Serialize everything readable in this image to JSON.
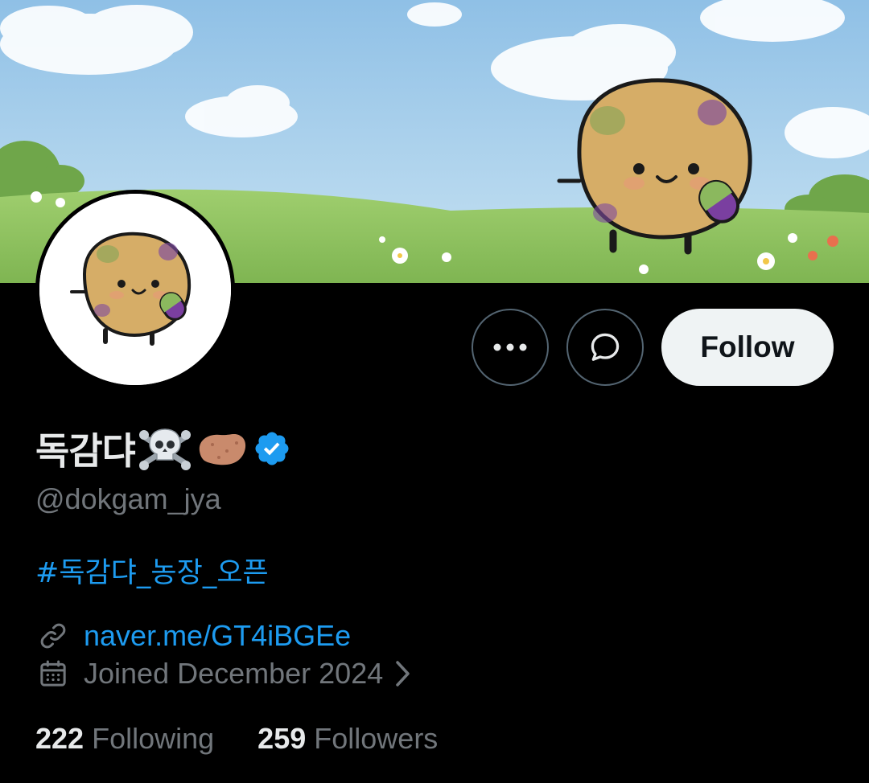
{
  "profile": {
    "display_name": "독감댜",
    "name_emojis": [
      "skull-crossbones-emoji",
      "potato-emoji"
    ],
    "verified": true,
    "handle": "@dokgam_jya",
    "bio_hashtag": "#독감댜_농장_오픈",
    "link": "naver.me/GT4iBGEe",
    "joined": "Joined December 2024",
    "following_count": "222",
    "following_label": "Following",
    "followers_count": "259",
    "followers_label": "Followers"
  },
  "actions": {
    "more_icon": "more-dots-icon",
    "message_icon": "message-bubble-icon",
    "follow_label": "Follow"
  },
  "colors": {
    "background": "#000000",
    "accent": "#1d9bf0",
    "text_primary": "#e7e9ea",
    "text_secondary": "#71767b",
    "follow_button_bg": "#eff3f4",
    "border": "#536471"
  }
}
